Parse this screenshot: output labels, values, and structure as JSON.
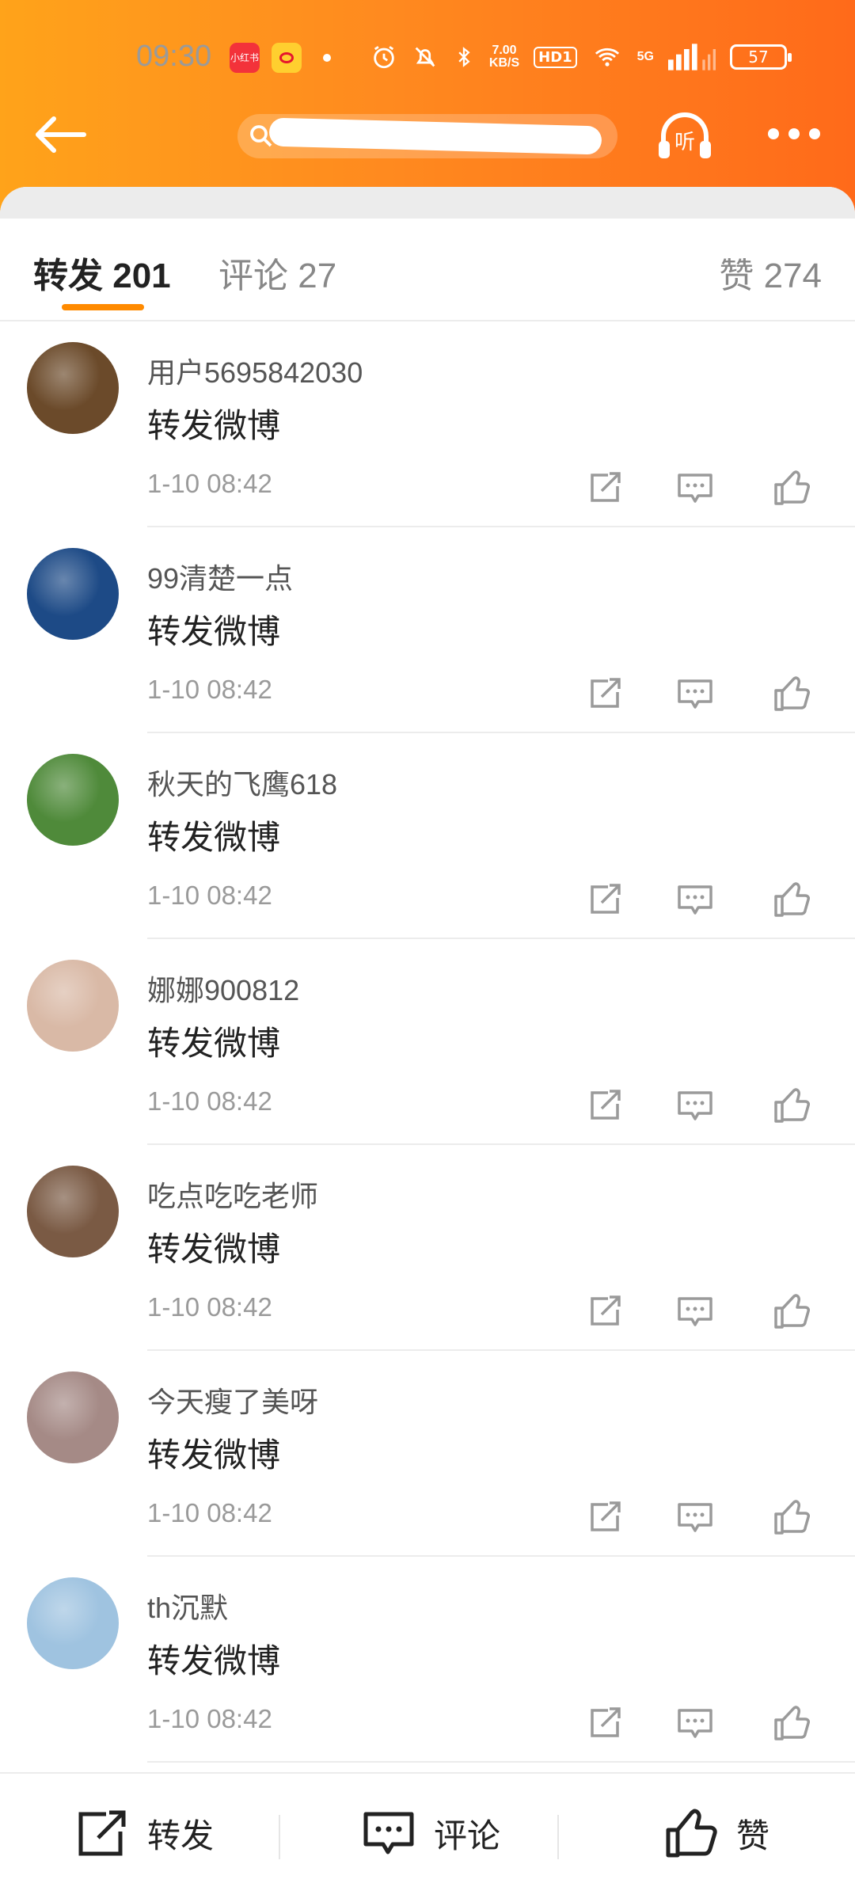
{
  "status_bar": {
    "time": "09:30",
    "app_badge": "小红书",
    "net_speed_top": "7.00",
    "net_speed_bottom": "KB/S",
    "hd": "HD1",
    "signal": "5G",
    "battery": "57"
  },
  "nav": {
    "title_tail": "...",
    "listen_label": "听"
  },
  "tabs": {
    "repost": "转发 201",
    "comment": "评论 27",
    "like": "赞 274"
  },
  "colors": {
    "brand_orange": "#ff8a00",
    "header_gradient_start": "#ffa31a",
    "header_gradient_end": "#ff6a1a"
  },
  "items": [
    {
      "user": "用户5695842030",
      "content": "转发微博",
      "time": "1-10 08:42",
      "avatar_color": "#6b4a2a"
    },
    {
      "user": "99清楚一点",
      "content": "转发微博",
      "time": "1-10 08:42",
      "avatar_color": "#1d4a86"
    },
    {
      "user": "秋天的飞鹰618",
      "content": "转发微博",
      "time": "1-10 08:42",
      "avatar_color": "#4f8a3a"
    },
    {
      "user": "娜娜900812",
      "content": "转发微博",
      "time": "1-10 08:42",
      "avatar_color": "#d9b9a6"
    },
    {
      "user": "吃点吃吃老师",
      "content": "转发微博",
      "time": "1-10 08:42",
      "avatar_color": "#7a5a44"
    },
    {
      "user": "今天瘦了美呀",
      "content": "转发微博",
      "time": "1-10 08:42",
      "avatar_color": "#a58a86"
    },
    {
      "user": "th沉默",
      "content": "转发微博",
      "time": "1-10 08:42",
      "avatar_color": "#9fc3e0"
    }
  ],
  "bottom_bar": {
    "repost": "转发",
    "comment": "评论",
    "like": "赞"
  },
  "icons": [
    "back-arrow-icon",
    "search-icon",
    "headphones-icon",
    "more-icon",
    "repost-icon",
    "comment-icon",
    "like-icon"
  ]
}
